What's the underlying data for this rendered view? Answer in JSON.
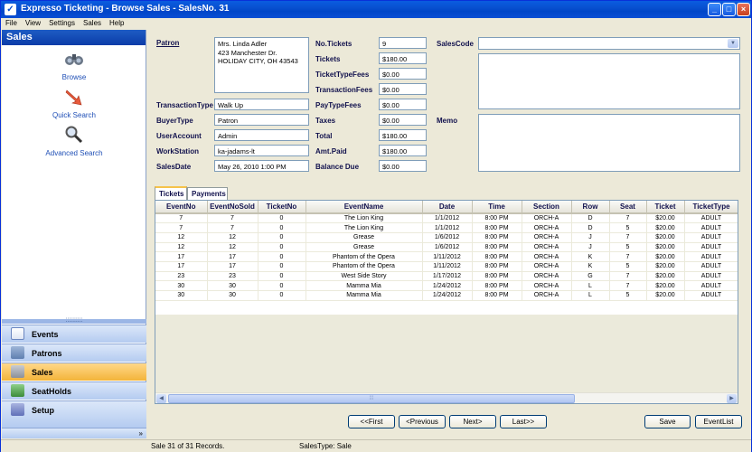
{
  "window": {
    "title": "Expresso Ticketing - Browse Sales - SalesNo. 31"
  },
  "menu": [
    "File",
    "View",
    "Settings",
    "Sales",
    "Help"
  ],
  "sidebar": {
    "header": "Sales",
    "quick_actions": [
      {
        "label": "Browse",
        "icon": "binoculars-icon"
      },
      {
        "label": "Quick Search",
        "icon": "arrow-search-icon"
      },
      {
        "label": "Advanced Search",
        "icon": "magnifier-icon"
      }
    ],
    "nav": [
      {
        "label": "Events",
        "icon": "calendar-icon"
      },
      {
        "label": "Patrons",
        "icon": "patrons-icon"
      },
      {
        "label": "Sales",
        "icon": "sales-icon"
      },
      {
        "label": "SeatHolds",
        "icon": "seatholds-icon"
      },
      {
        "label": "Setup",
        "icon": "setup-icon"
      }
    ],
    "footer_chevron": "»"
  },
  "form": {
    "patron_label": "Patron",
    "patron_lines": [
      "Mrs. Linda Adler",
      "423 Manchester Dr.",
      "HOLIDAY CITY, OH  43543"
    ],
    "transaction_type_label": "TransactionType",
    "transaction_type": "Walk Up",
    "buyer_type_label": "BuyerType",
    "buyer_type": "Patron",
    "user_account_label": "UserAccount",
    "user_account": "Admin",
    "workstation_label": "WorkStation",
    "workstation": "ka-jadams-lt",
    "sales_date_label": "SalesDate",
    "sales_date": "May 26, 2010  1:00  PM",
    "no_tickets_label": "No.Tickets",
    "no_tickets": "9",
    "tickets_label": "Tickets",
    "tickets": "$180.00",
    "ticket_type_fees_label": "TicketTypeFees",
    "ticket_type_fees": "$0.00",
    "transaction_fees_label": "TransactionFees",
    "transaction_fees": "$0.00",
    "pay_type_fees_label": "PayTypeFees",
    "pay_type_fees": "$0.00",
    "taxes_label": "Taxes",
    "taxes": "$0.00",
    "total_label": "Total",
    "total": "$180.00",
    "amt_paid_label": "Amt.Paid",
    "amt_paid": "$180.00",
    "balance_due_label": "Balance Due",
    "balance_due": "$0.00",
    "sales_code_label": "SalesCode",
    "sales_code": "",
    "memo_label": "Memo",
    "memo": ""
  },
  "tabs": [
    "Tickets",
    "Payments"
  ],
  "grid": {
    "columns": [
      "EventNo",
      "EventNoSold",
      "TicketNo",
      "EventName",
      "Date",
      "Time",
      "Section",
      "Row",
      "Seat",
      "Ticket",
      "TicketType"
    ],
    "rows": [
      [
        "7",
        "7",
        "0",
        "The Lion King",
        "1/1/2012",
        "8:00 PM",
        "ORCH-A",
        "D",
        "7",
        "$20.00",
        "ADULT"
      ],
      [
        "7",
        "7",
        "0",
        "The Lion King",
        "1/1/2012",
        "8:00 PM",
        "ORCH-A",
        "D",
        "5",
        "$20.00",
        "ADULT"
      ],
      [
        "12",
        "12",
        "0",
        "Grease",
        "1/6/2012",
        "8:00 PM",
        "ORCH-A",
        "J",
        "7",
        "$20.00",
        "ADULT"
      ],
      [
        "12",
        "12",
        "0",
        "Grease",
        "1/6/2012",
        "8:00 PM",
        "ORCH-A",
        "J",
        "5",
        "$20.00",
        "ADULT"
      ],
      [
        "17",
        "17",
        "0",
        "Phantom of the Opera",
        "1/11/2012",
        "8:00 PM",
        "ORCH-A",
        "K",
        "7",
        "$20.00",
        "ADULT"
      ],
      [
        "17",
        "17",
        "0",
        "Phantom of the Opera",
        "1/11/2012",
        "8:00 PM",
        "ORCH-A",
        "K",
        "5",
        "$20.00",
        "ADULT"
      ],
      [
        "23",
        "23",
        "0",
        "West Side Story",
        "1/17/2012",
        "8:00 PM",
        "ORCH-A",
        "G",
        "7",
        "$20.00",
        "ADULT"
      ],
      [
        "30",
        "30",
        "0",
        "Mamma Mia",
        "1/24/2012",
        "8:00 PM",
        "ORCH-A",
        "L",
        "7",
        "$20.00",
        "ADULT"
      ],
      [
        "30",
        "30",
        "0",
        "Mamma Mia",
        "1/24/2012",
        "8:00 PM",
        "ORCH-A",
        "L",
        "5",
        "$20.00",
        "ADULT"
      ]
    ]
  },
  "buttons": {
    "first": "<<First",
    "previous": "<Previous",
    "next": "Next>",
    "last": "Last>>",
    "save": "Save",
    "eventlist": "EventList"
  },
  "status": {
    "records": "Sale 31 of 31 Records.",
    "sales_type": "SalesType: Sale"
  }
}
